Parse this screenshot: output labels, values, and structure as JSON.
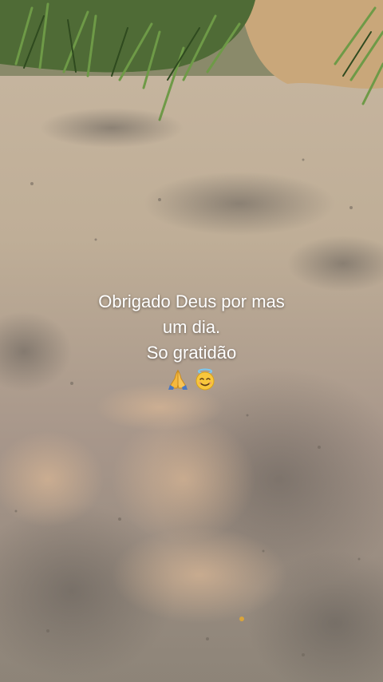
{
  "story": {
    "caption": {
      "line1": "Obrigado Deus por mas",
      "line2": "um dia.",
      "line3": "So gratidão"
    },
    "emojis": [
      {
        "name": "folded-hands-icon",
        "glyph": "🙏"
      },
      {
        "name": "smiling-face-with-halo-icon",
        "glyph": "😇"
      }
    ],
    "colors": {
      "caption_text": "#ffffff",
      "ground": "#b9a58e",
      "grass": "#3f6a2a"
    }
  }
}
